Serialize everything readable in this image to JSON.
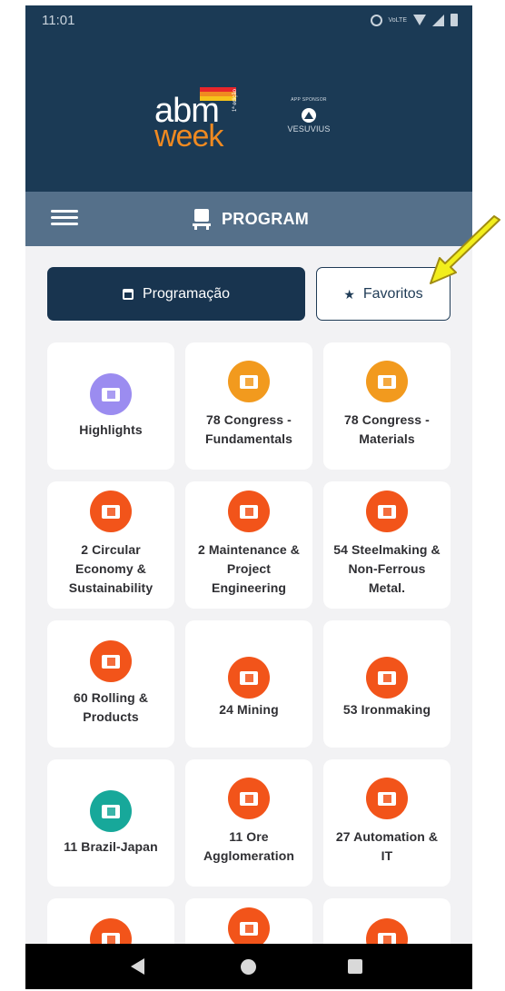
{
  "status_bar": {
    "time": "11:01",
    "net_label": "VoLTE"
  },
  "header": {
    "logo_top": "abm",
    "logo_bottom": "week",
    "logo_edition": "1ª edição",
    "sponsor_label": "APP SPONSOR",
    "sponsor_name": "VESUVIUS"
  },
  "toolbar": {
    "title": "PROGRAM",
    "menu_icon": "hamburger-icon",
    "title_icon": "podium-icon"
  },
  "tabs": [
    {
      "label": "Programação",
      "icon": "calendar-icon",
      "selected": true
    },
    {
      "label": "Favoritos",
      "icon": "star-icon",
      "selected": false
    }
  ],
  "cards": [
    {
      "label": "Highlights",
      "color": "#9b8cf0"
    },
    {
      "label": "78 Congress - Fundamentals",
      "color": "#f29a1e"
    },
    {
      "label": "78 Congress - Materials",
      "color": "#f29a1e"
    },
    {
      "label": "2 Circular Economy & Sustainability",
      "color": "#f2541a"
    },
    {
      "label": "2 Maintenance & Project Engineering",
      "color": "#f2541a"
    },
    {
      "label": "54 Steelmaking & Non-Ferrous Metal.",
      "color": "#f2541a"
    },
    {
      "label": "60 Rolling & Products",
      "color": "#f2541a"
    },
    {
      "label": "24 Mining",
      "color": "#f2541a"
    },
    {
      "label": "53 Ironmaking",
      "color": "#f2541a"
    },
    {
      "label": "11 Brazil-Japan",
      "color": "#17a89a"
    },
    {
      "label": "11 Ore Agglomeration",
      "color": "#f2541a"
    },
    {
      "label": "27 Automation & IT",
      "color": "#f2541a"
    },
    {
      "label": "",
      "color": "#f2541a"
    },
    {
      "label": "",
      "color": "#f2541a"
    },
    {
      "label": "",
      "color": "#f2541a"
    }
  ],
  "colors": {
    "header_bg": "#1b3a55",
    "toolbar_bg": "#55708a",
    "selected_tab_bg": "#18344f",
    "annotation_arrow": "#f2ee1c"
  }
}
